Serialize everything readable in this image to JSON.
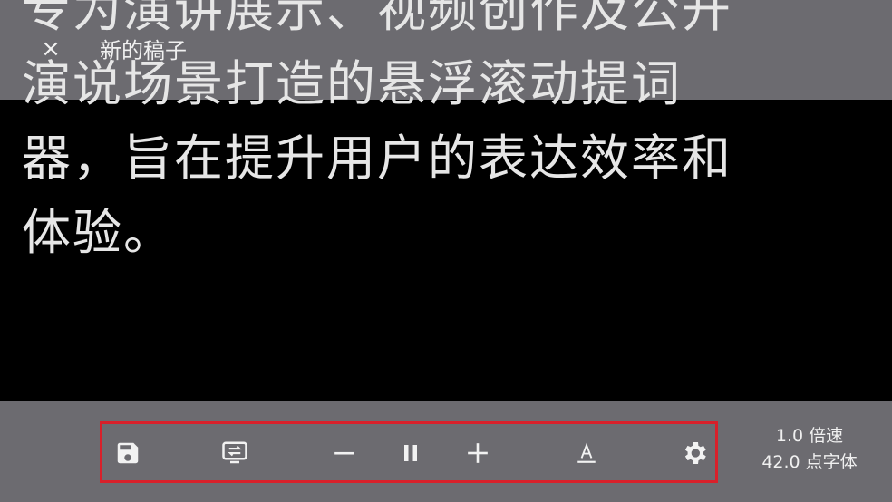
{
  "header": {
    "close_label": "×",
    "title": "新的稿子"
  },
  "script": {
    "lines": [
      "专为演讲展示、视频创作及公开",
      "演说场景打造的悬浮滚动提词",
      "器，旨在提升用户的表达效率和",
      "体验。"
    ]
  },
  "toolbar": {
    "highlight_color": "#d8202a",
    "buttons": [
      {
        "name": "save",
        "icon": "save-icon"
      },
      {
        "name": "display-mode",
        "icon": "screen-swap-icon"
      },
      {
        "name": "decrease",
        "label": "−",
        "icon": "minus-icon"
      },
      {
        "name": "pause",
        "icon": "pause-icon"
      },
      {
        "name": "increase",
        "label": "+",
        "icon": "plus-icon"
      },
      {
        "name": "text-style",
        "icon": "text-format-icon"
      },
      {
        "name": "settings",
        "icon": "gear-icon"
      }
    ]
  },
  "status": {
    "speed": "1.0 倍速",
    "font_size": "42.0 点字体"
  }
}
